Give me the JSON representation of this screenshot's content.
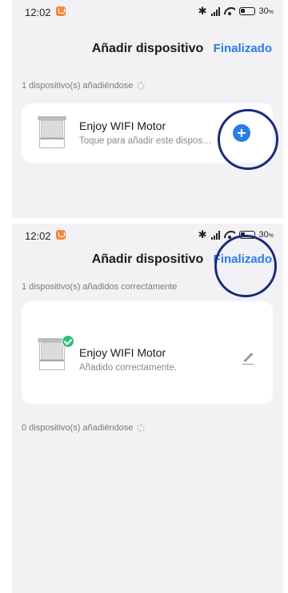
{
  "screens": [
    {
      "status": {
        "time": "12:02",
        "battery": "30",
        "battery_unit": "%"
      },
      "nav": {
        "title": "Añadir dispositivo",
        "done": "Finalizado"
      },
      "adding_label": "1 dispositivo(s) añadiéndose",
      "device": {
        "name": "Enjoy WIFI Motor",
        "subtitle": "Toque para añadir este dispositivo"
      }
    },
    {
      "status": {
        "time": "12:02",
        "battery": "30",
        "battery_unit": "%"
      },
      "nav": {
        "title": "Añadir dispositivo",
        "done": "Finalizado"
      },
      "added_label": "1 dispositivo(s) añadidos correctamente",
      "device": {
        "name": "Enjoy WIFI Motor",
        "subtitle": "Añadido correctamente."
      },
      "adding_label": "0 dispositivo(s) añadiéndose"
    }
  ],
  "colors": {
    "accent": "#2a7ce6",
    "success": "#2ec27e",
    "highlight": "#1b2a78",
    "background": "#f2f2f4"
  },
  "icons": [
    "notification-icon",
    "bluetooth-icon",
    "signal-icon",
    "wifi-icon",
    "battery-icon",
    "loading-spinner-icon",
    "add-icon",
    "check-icon",
    "edit-icon"
  ]
}
